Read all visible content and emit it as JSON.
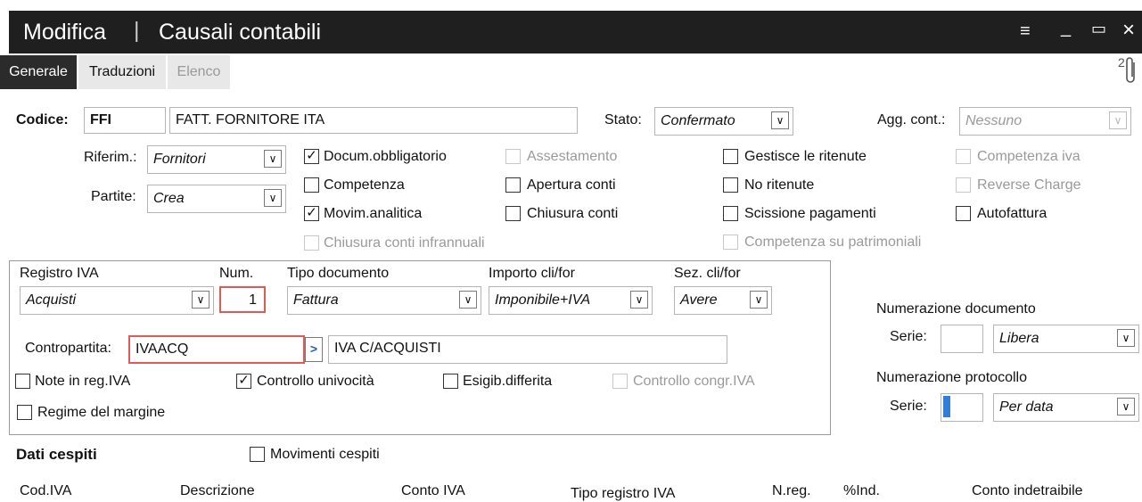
{
  "window": {
    "mode": "Modifica",
    "separator": "|",
    "title": "Causali contabili",
    "menu_glyph": "≡",
    "min_glyph": "_",
    "max_glyph": "▭",
    "close_glyph": "×"
  },
  "tabs": {
    "generale": "Generale",
    "traduzioni": "Traduzioni",
    "elenco": "Elenco"
  },
  "attachments": {
    "count": "2",
    "icon": "paperclip-icon"
  },
  "header": {
    "codice_label": "Codice:",
    "codice_value": "FFI",
    "descrizione_value": "FATT. FORNITORE ITA",
    "stato_label": "Stato:",
    "stato_value": "Confermato",
    "agg_label": "Agg. cont.:",
    "agg_value": "Nessuno"
  },
  "riferim": {
    "label": "Riferim.:",
    "value": "Fornitori"
  },
  "partite": {
    "label": "Partite:",
    "value": "Crea"
  },
  "checks": {
    "docum_obbligatorio": "Docum.obbligatorio",
    "competenza": "Competenza",
    "movim_analitica": "Movim.analitica",
    "chiusura_infrannuali": "Chiusura conti infrannuali",
    "assestamento": "Assestamento",
    "apertura_conti": "Apertura conti",
    "chiusura_conti": "Chiusura conti",
    "gestisce_ritenute": "Gestisce le ritenute",
    "no_ritenute": "No ritenute",
    "scissione_pagamenti": "Scissione pagamenti",
    "competenza_patrimoniali": "Competenza su patrimoniali",
    "competenza_iva": "Competenza iva",
    "reverse_charge": "Reverse Charge",
    "autofattura": "Autofattura"
  },
  "iva": {
    "registro_label": "Registro IVA",
    "registro_value": "Acquisti",
    "num_label": "Num.",
    "num_value": "1",
    "tipo_doc_label": "Tipo documento",
    "tipo_doc_value": "Fattura",
    "importo_label": "Importo cli/for",
    "importo_value": "Imponibile+IVA",
    "sez_label": "Sez. cli/for",
    "sez_value": "Avere",
    "contropartita_label": "Contropartita:",
    "contropartita_code": "IVAACQ",
    "contropartita_desc": "IVA C/ACQUISTI",
    "zoom_glyph": ">",
    "note_reg": "Note in reg.IVA",
    "controllo_univocita": "Controllo univocità",
    "esigib_differita": "Esigib.differita",
    "controllo_congr": "Controllo congr.IVA",
    "regime_margine": "Regime del margine"
  },
  "numerazione": {
    "documento_label": "Numerazione documento",
    "serie_label": "Serie:",
    "documento_value": "Libera",
    "protocollo_label": "Numerazione protocollo",
    "serie2_label": "Serie:",
    "protocollo_value": "Per data"
  },
  "cespiti": {
    "title": "Dati cespiti",
    "movimenti": "Movimenti cespiti"
  },
  "table_headers": [
    "Cod.IVA",
    "Descrizione",
    "Conto IVA",
    "Tipo registro IVA",
    "N.reg.",
    "%Ind.",
    "Conto indetraibile"
  ],
  "glyphs": {
    "check": "✓",
    "arrow": "∨"
  }
}
